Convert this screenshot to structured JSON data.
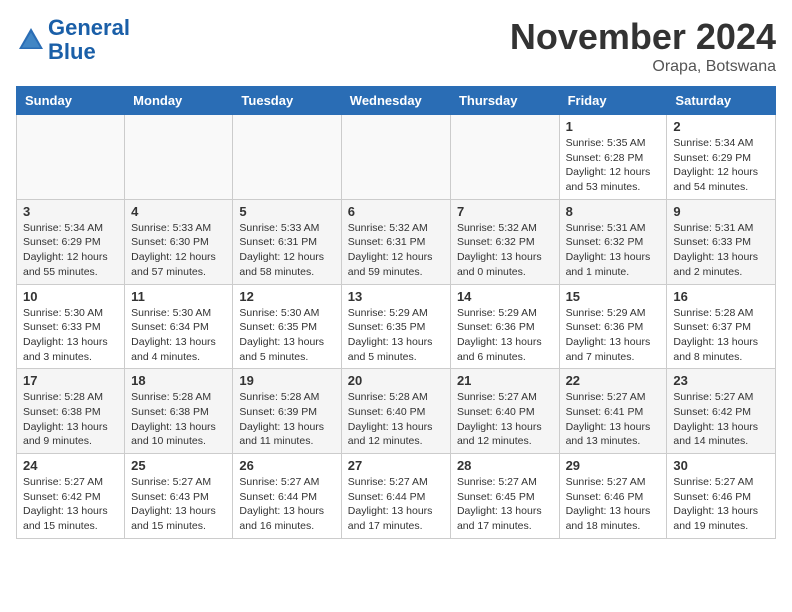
{
  "logo": {
    "line1": "General",
    "line2": "Blue"
  },
  "title": "November 2024",
  "location": "Orapa, Botswana",
  "days_of_week": [
    "Sunday",
    "Monday",
    "Tuesday",
    "Wednesday",
    "Thursday",
    "Friday",
    "Saturday"
  ],
  "weeks": [
    [
      {
        "day": "",
        "info": ""
      },
      {
        "day": "",
        "info": ""
      },
      {
        "day": "",
        "info": ""
      },
      {
        "day": "",
        "info": ""
      },
      {
        "day": "",
        "info": ""
      },
      {
        "day": "1",
        "info": "Sunrise: 5:35 AM\nSunset: 6:28 PM\nDaylight: 12 hours and 53 minutes."
      },
      {
        "day": "2",
        "info": "Sunrise: 5:34 AM\nSunset: 6:29 PM\nDaylight: 12 hours and 54 minutes."
      }
    ],
    [
      {
        "day": "3",
        "info": "Sunrise: 5:34 AM\nSunset: 6:29 PM\nDaylight: 12 hours and 55 minutes."
      },
      {
        "day": "4",
        "info": "Sunrise: 5:33 AM\nSunset: 6:30 PM\nDaylight: 12 hours and 57 minutes."
      },
      {
        "day": "5",
        "info": "Sunrise: 5:33 AM\nSunset: 6:31 PM\nDaylight: 12 hours and 58 minutes."
      },
      {
        "day": "6",
        "info": "Sunrise: 5:32 AM\nSunset: 6:31 PM\nDaylight: 12 hours and 59 minutes."
      },
      {
        "day": "7",
        "info": "Sunrise: 5:32 AM\nSunset: 6:32 PM\nDaylight: 13 hours and 0 minutes."
      },
      {
        "day": "8",
        "info": "Sunrise: 5:31 AM\nSunset: 6:32 PM\nDaylight: 13 hours and 1 minute."
      },
      {
        "day": "9",
        "info": "Sunrise: 5:31 AM\nSunset: 6:33 PM\nDaylight: 13 hours and 2 minutes."
      }
    ],
    [
      {
        "day": "10",
        "info": "Sunrise: 5:30 AM\nSunset: 6:33 PM\nDaylight: 13 hours and 3 minutes."
      },
      {
        "day": "11",
        "info": "Sunrise: 5:30 AM\nSunset: 6:34 PM\nDaylight: 13 hours and 4 minutes."
      },
      {
        "day": "12",
        "info": "Sunrise: 5:30 AM\nSunset: 6:35 PM\nDaylight: 13 hours and 5 minutes."
      },
      {
        "day": "13",
        "info": "Sunrise: 5:29 AM\nSunset: 6:35 PM\nDaylight: 13 hours and 5 minutes."
      },
      {
        "day": "14",
        "info": "Sunrise: 5:29 AM\nSunset: 6:36 PM\nDaylight: 13 hours and 6 minutes."
      },
      {
        "day": "15",
        "info": "Sunrise: 5:29 AM\nSunset: 6:36 PM\nDaylight: 13 hours and 7 minutes."
      },
      {
        "day": "16",
        "info": "Sunrise: 5:28 AM\nSunset: 6:37 PM\nDaylight: 13 hours and 8 minutes."
      }
    ],
    [
      {
        "day": "17",
        "info": "Sunrise: 5:28 AM\nSunset: 6:38 PM\nDaylight: 13 hours and 9 minutes."
      },
      {
        "day": "18",
        "info": "Sunrise: 5:28 AM\nSunset: 6:38 PM\nDaylight: 13 hours and 10 minutes."
      },
      {
        "day": "19",
        "info": "Sunrise: 5:28 AM\nSunset: 6:39 PM\nDaylight: 13 hours and 11 minutes."
      },
      {
        "day": "20",
        "info": "Sunrise: 5:28 AM\nSunset: 6:40 PM\nDaylight: 13 hours and 12 minutes."
      },
      {
        "day": "21",
        "info": "Sunrise: 5:27 AM\nSunset: 6:40 PM\nDaylight: 13 hours and 12 minutes."
      },
      {
        "day": "22",
        "info": "Sunrise: 5:27 AM\nSunset: 6:41 PM\nDaylight: 13 hours and 13 minutes."
      },
      {
        "day": "23",
        "info": "Sunrise: 5:27 AM\nSunset: 6:42 PM\nDaylight: 13 hours and 14 minutes."
      }
    ],
    [
      {
        "day": "24",
        "info": "Sunrise: 5:27 AM\nSunset: 6:42 PM\nDaylight: 13 hours and 15 minutes."
      },
      {
        "day": "25",
        "info": "Sunrise: 5:27 AM\nSunset: 6:43 PM\nDaylight: 13 hours and 15 minutes."
      },
      {
        "day": "26",
        "info": "Sunrise: 5:27 AM\nSunset: 6:44 PM\nDaylight: 13 hours and 16 minutes."
      },
      {
        "day": "27",
        "info": "Sunrise: 5:27 AM\nSunset: 6:44 PM\nDaylight: 13 hours and 17 minutes."
      },
      {
        "day": "28",
        "info": "Sunrise: 5:27 AM\nSunset: 6:45 PM\nDaylight: 13 hours and 17 minutes."
      },
      {
        "day": "29",
        "info": "Sunrise: 5:27 AM\nSunset: 6:46 PM\nDaylight: 13 hours and 18 minutes."
      },
      {
        "day": "30",
        "info": "Sunrise: 5:27 AM\nSunset: 6:46 PM\nDaylight: 13 hours and 19 minutes."
      }
    ]
  ]
}
